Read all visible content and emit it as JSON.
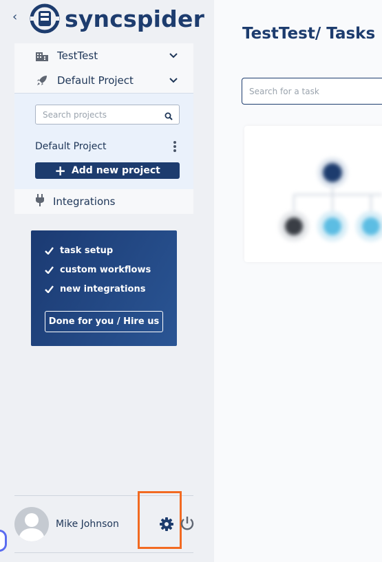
{
  "brand": {
    "name": "syncspider"
  },
  "sidebar": {
    "collapse_icon": "chevron-left",
    "workspace": {
      "label": "TestTest",
      "icon": "building-icon"
    },
    "project": {
      "label": "Default Project",
      "icon": "rocket-icon"
    },
    "project_search": {
      "placeholder": "Search projects"
    },
    "projects": [
      {
        "name": "Default Project"
      }
    ],
    "add_project_label": "Add new project",
    "integrations": {
      "label": "Integrations",
      "icon": "plug-icon"
    }
  },
  "promo": {
    "items": [
      "task setup",
      "custom workflows",
      "new integrations"
    ],
    "button_label": "Done for you / Hire us"
  },
  "user": {
    "name": "Mike Johnson"
  },
  "main": {
    "title": "TestTest/ Tasks",
    "search": {
      "placeholder": "Search for a task"
    }
  },
  "colors": {
    "brand_navy": "#1d3c6e",
    "sidebar_bg": "#eef0f4",
    "highlight": "#f26a21"
  }
}
